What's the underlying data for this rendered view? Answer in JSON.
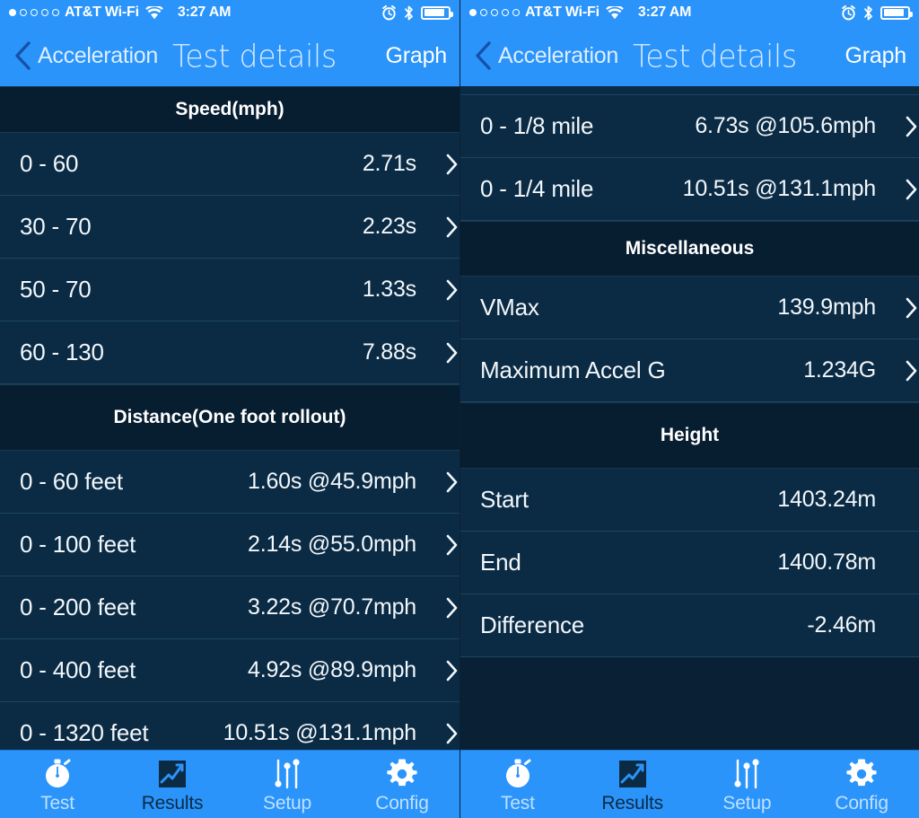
{
  "status_bar": {
    "signal_dots_filled": 1,
    "signal_dots_total": 5,
    "carrier": "AT&T Wi-Fi",
    "wifi_icon": "wifi-icon",
    "time": "3:27 AM",
    "alarm_icon": "alarm-clock-icon",
    "bluetooth_icon": "bluetooth-icon",
    "battery_icon": "battery-icon",
    "battery_level_percent": 88
  },
  "nav_bar": {
    "back_icon": "chevron-left-icon",
    "back_label": "Acceleration",
    "title": "Test details",
    "right_action": "Graph"
  },
  "tab_bar": {
    "tabs": [
      {
        "label": "Test",
        "icon": "stopwatch-icon",
        "active": false
      },
      {
        "label": "Results",
        "icon": "chart-square-icon",
        "active": true
      },
      {
        "label": "Setup",
        "icon": "sliders-icon",
        "active": false
      },
      {
        "label": "Config",
        "icon": "gear-icon",
        "active": false
      }
    ]
  },
  "accent_color": "#2a94fb",
  "background_color": "#0a2135",
  "row_color": "#0b2b44",
  "section_header_color": "#071d30",
  "left_panel": {
    "sections": [
      {
        "title": "Speed(mph)",
        "rows": [
          {
            "label": "0 - 60",
            "value": "2.71s",
            "chevron": true
          },
          {
            "label": "30 - 70",
            "value": "2.23s",
            "chevron": true
          },
          {
            "label": "50 - 70",
            "value": "1.33s",
            "chevron": true
          },
          {
            "label": "60 - 130",
            "value": "7.88s",
            "chevron": true
          }
        ]
      },
      {
        "title": "Distance(One foot rollout)",
        "rows": [
          {
            "label": "0 - 60 feet",
            "value": "1.60s @45.9mph",
            "chevron": true
          },
          {
            "label": "0 - 100 feet",
            "value": "2.14s @55.0mph",
            "chevron": true
          },
          {
            "label": "0 - 200 feet",
            "value": "3.22s @70.7mph",
            "chevron": true
          },
          {
            "label": "0 - 400 feet",
            "value": "4.92s @89.9mph",
            "chevron": true
          },
          {
            "label": "0 - 1320 feet",
            "value": "10.51s @131.1mph",
            "chevron": true
          }
        ]
      }
    ]
  },
  "right_panel": {
    "sections": [
      {
        "title": "",
        "clipped_top_row": {
          "label": "",
          "value": "",
          "chevron": true
        },
        "rows": [
          {
            "label": "0 - 1/8 mile",
            "value": "6.73s @105.6mph",
            "chevron": true
          },
          {
            "label": "0 - 1/4 mile",
            "value": "10.51s @131.1mph",
            "chevron": true
          }
        ]
      },
      {
        "title": "Miscellaneous",
        "rows": [
          {
            "label": "VMax",
            "value": "139.9mph",
            "chevron": true
          },
          {
            "label": "Maximum Accel G",
            "value": "1.234G",
            "chevron": true
          }
        ]
      },
      {
        "title": "Height",
        "rows": [
          {
            "label": "Start",
            "value": "1403.24m",
            "chevron": false
          },
          {
            "label": "End",
            "value": "1400.78m",
            "chevron": false
          },
          {
            "label": "Difference",
            "value": "-2.46m",
            "chevron": false
          }
        ]
      }
    ]
  }
}
